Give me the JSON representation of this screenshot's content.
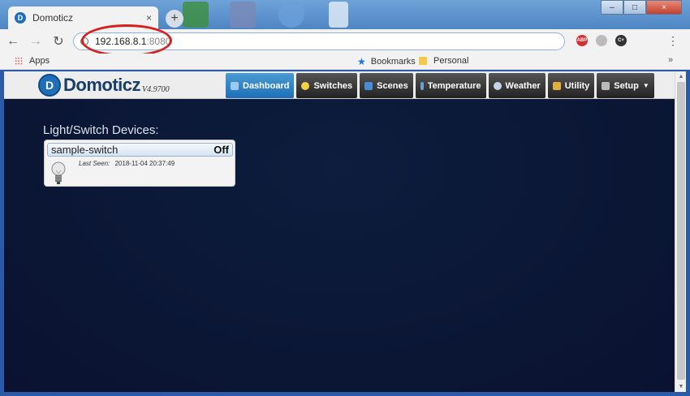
{
  "browser": {
    "tab_title": "Domoticz",
    "tab_favicon": "D",
    "tab_close": "×",
    "new_tab": "+",
    "window_controls": [
      "–",
      "□",
      "×"
    ],
    "url_host": "192.168.8.1",
    "url_port": ":8080",
    "extensions": [
      "ABP",
      "",
      "C+"
    ],
    "nav": {
      "back": "←",
      "forward": "→",
      "reload": "↻",
      "menu": "⋮"
    }
  },
  "bookmarks": {
    "apps": "Apps",
    "bookmarks": "Bookmarks",
    "personal": "Personal",
    "more": "»"
  },
  "app": {
    "logo_letter": "D",
    "name": "Domoticz",
    "version": "V4.9700",
    "nav": [
      {
        "label": "Dashboard",
        "icon": "dashboard-icon",
        "active": true
      },
      {
        "label": "Switches",
        "icon": "lightbulb-icon"
      },
      {
        "label": "Scenes",
        "icon": "scenes-icon"
      },
      {
        "label": "Temperature",
        "icon": "thermometer-icon"
      },
      {
        "label": "Weather",
        "icon": "weather-icon"
      },
      {
        "label": "Utility",
        "icon": "utility-icon"
      },
      {
        "label": "Setup",
        "icon": "tools-icon",
        "dropdown": true
      }
    ]
  },
  "dashboard": {
    "section_title": "Light/Switch Devices:",
    "devices": [
      {
        "name": "sample-switch",
        "status": "Off",
        "last_seen_label": "Last Seen:",
        "last_seen": "2018-11-04 20:37:49",
        "icon": "lightbulb-off-icon"
      }
    ]
  },
  "colors": {
    "accent": "#1e6fb8",
    "page_bg": "#0a1230",
    "annotation": "#d81f1f"
  }
}
